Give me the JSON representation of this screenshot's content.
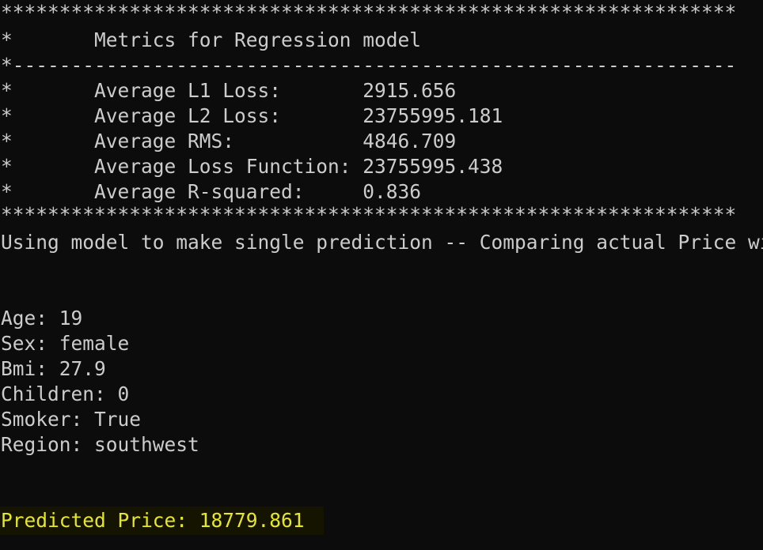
{
  "console": {
    "border_line": "***************************************************************",
    "title_line": "*       Metrics for Regression model",
    "separator_line": "*--------------------------------------------------------------",
    "metrics": [
      {
        "line": "*       Average L1 Loss:       2915.656"
      },
      {
        "line": "*       Average L2 Loss:       23755995.181"
      },
      {
        "line": "*       Average RMS:           4846.709"
      },
      {
        "line": "*       Average Loss Function: 23755995.438"
      },
      {
        "line": "*       Average R-squared:     0.836"
      }
    ],
    "message": "Using model to make single prediction -- Comparing actual Price with predicted Price from sample data...",
    "features": [
      "Age: 19",
      "Sex: female",
      "Bmi: 27.9",
      "Children: 0",
      "Smoker: True",
      "Region: southwest"
    ],
    "prediction": "Predicted Price: 18779.861",
    "colors": {
      "background": "#0c0c0c",
      "text": "#cccccc",
      "prediction": "#e6e62a",
      "prediction_highlight": "#141400"
    }
  }
}
